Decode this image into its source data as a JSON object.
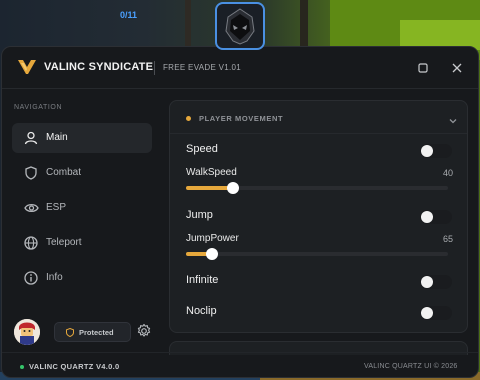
{
  "overlay": {
    "counter": "0/11"
  },
  "window": {
    "title": "VALINC SYNDICATE",
    "subtitle": "FREE EVADE V1.01"
  },
  "sidebar": {
    "heading": "NAVIGATION",
    "items": [
      {
        "label": "Main",
        "icon": "user-icon",
        "active": true
      },
      {
        "label": "Combat",
        "icon": "shield-icon",
        "active": false
      },
      {
        "label": "ESP",
        "icon": "eye-icon",
        "active": false
      },
      {
        "label": "Teleport",
        "icon": "globe-icon",
        "active": false
      },
      {
        "label": "Info",
        "icon": "info-icon",
        "active": false
      }
    ],
    "status": "Protected"
  },
  "section": {
    "title": "PLAYER MOVEMENT",
    "accent": "#e6a83c",
    "speed": {
      "label": "Speed",
      "on": false
    },
    "walkspeed": {
      "label": "WalkSpeed",
      "value": "40",
      "fill": 0.18
    },
    "jump": {
      "label": "Jump",
      "on": false
    },
    "jumppower": {
      "label": "JumpPower",
      "value": "65",
      "fill": 0.1
    },
    "infinite": {
      "label": "Infinite",
      "on": false
    },
    "noclip": {
      "label": "Noclip",
      "on": false
    }
  },
  "footer": {
    "left": "VALINC QUARTZ V4.0.0",
    "right": "VALINC QUARTZ UI © 2026",
    "status_color": "#35c46a"
  }
}
